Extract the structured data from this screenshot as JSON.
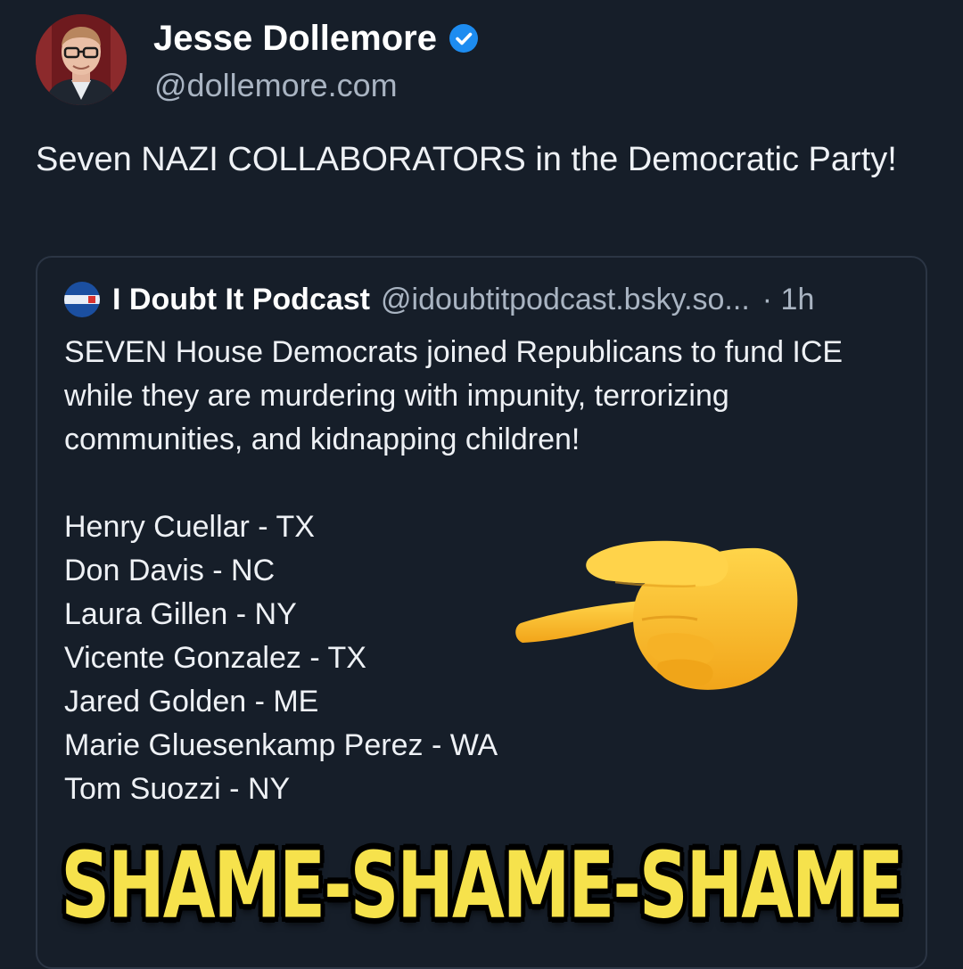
{
  "author": {
    "name": "Jesse Dollemore",
    "handle": "@dollemore.com",
    "verified": true,
    "avatar_icon": "person-avatar"
  },
  "post": {
    "text": "Seven NAZI COLLABORATORS in the Democratic Party!"
  },
  "quote": {
    "name": "I Doubt It Podcast",
    "handle": "@idoubtitpodcast.bsky.so...",
    "time": "· 1h",
    "avatar_icon": "podcast-logo",
    "text": "SEVEN House Democrats joined Republicans to fund ICE while they are murdering with impunity, terrorizing communities, and kidnapping children!",
    "members": [
      "Henry Cuellar - TX",
      "Don Davis - NC",
      "Laura Gillen - NY",
      "Vicente Gonzalez - TX",
      "Jared Golden - ME",
      "Marie Gluesenkamp Perez - WA",
      "Tom Suozzi - NY"
    ]
  },
  "overlay": {
    "emoji_icon": "pointing-hand-left",
    "caption": "SHAME-SHAME-SHAME"
  },
  "colors": {
    "background": "#161e29",
    "verified_badge": "#1d8cf0",
    "caption": "#f6e24c",
    "secondary_text": "#a9b4c2"
  }
}
